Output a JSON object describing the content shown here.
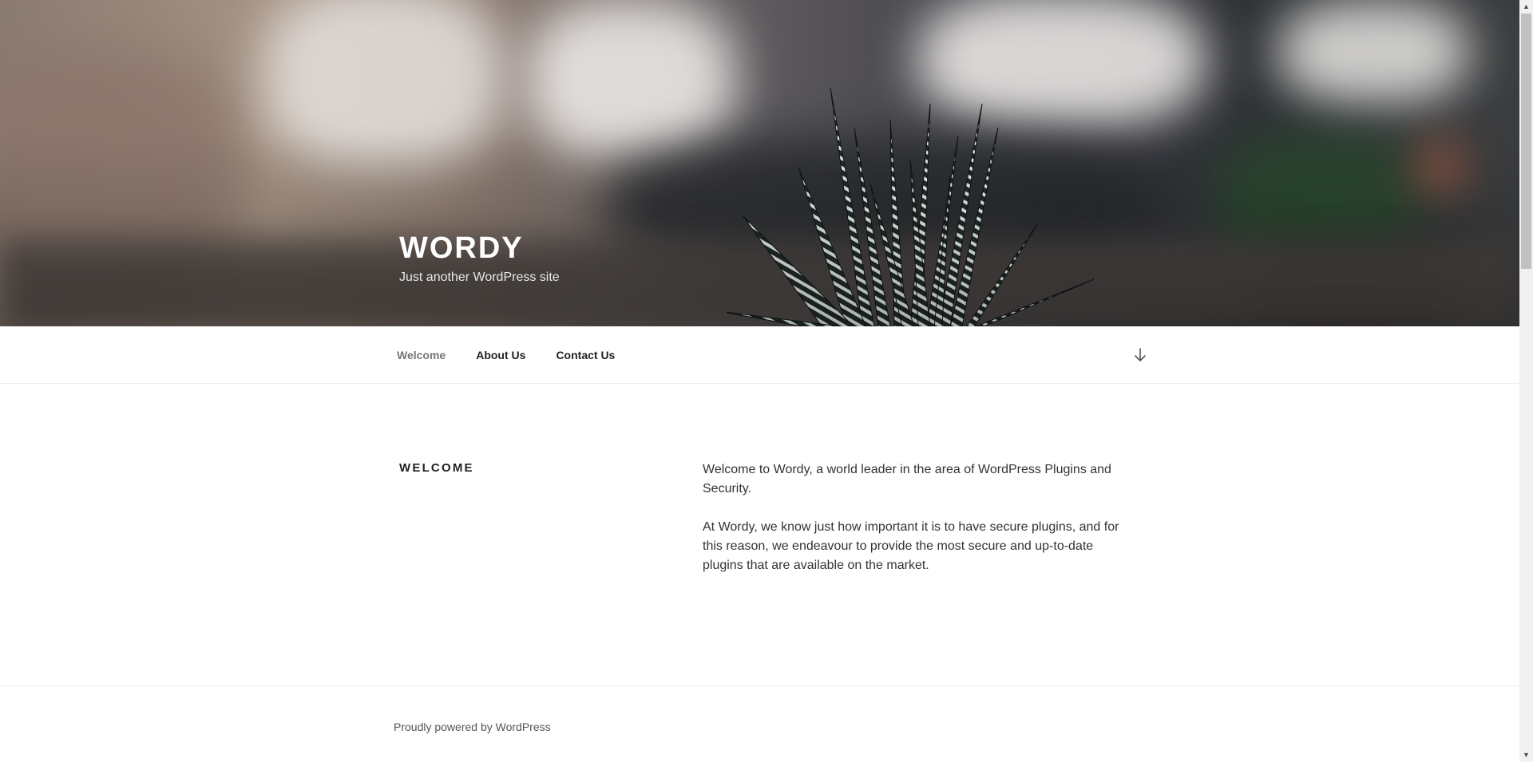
{
  "site": {
    "title": "WORDY",
    "description": "Just another WordPress site"
  },
  "nav": {
    "items": [
      {
        "label": "Welcome",
        "current": true
      },
      {
        "label": "About Us",
        "current": false
      },
      {
        "label": "Contact Us",
        "current": false
      }
    ],
    "scroll_icon": "arrow-down-icon"
  },
  "page": {
    "title": "WELCOME",
    "paragraphs": [
      "Welcome to Wordy, a world leader in the area of WordPress Plugins and Security.",
      "At Wordy, we know just how important it is to have secure plugins, and for this reason, we endeavour to provide the most secure and up-to-date plugins that are available on the market."
    ]
  },
  "footer": {
    "powered_by": "Proudly powered by WordPress"
  },
  "scrollbar": {
    "up_icon": "chevron-up-icon",
    "down_icon": "chevron-down-icon"
  }
}
